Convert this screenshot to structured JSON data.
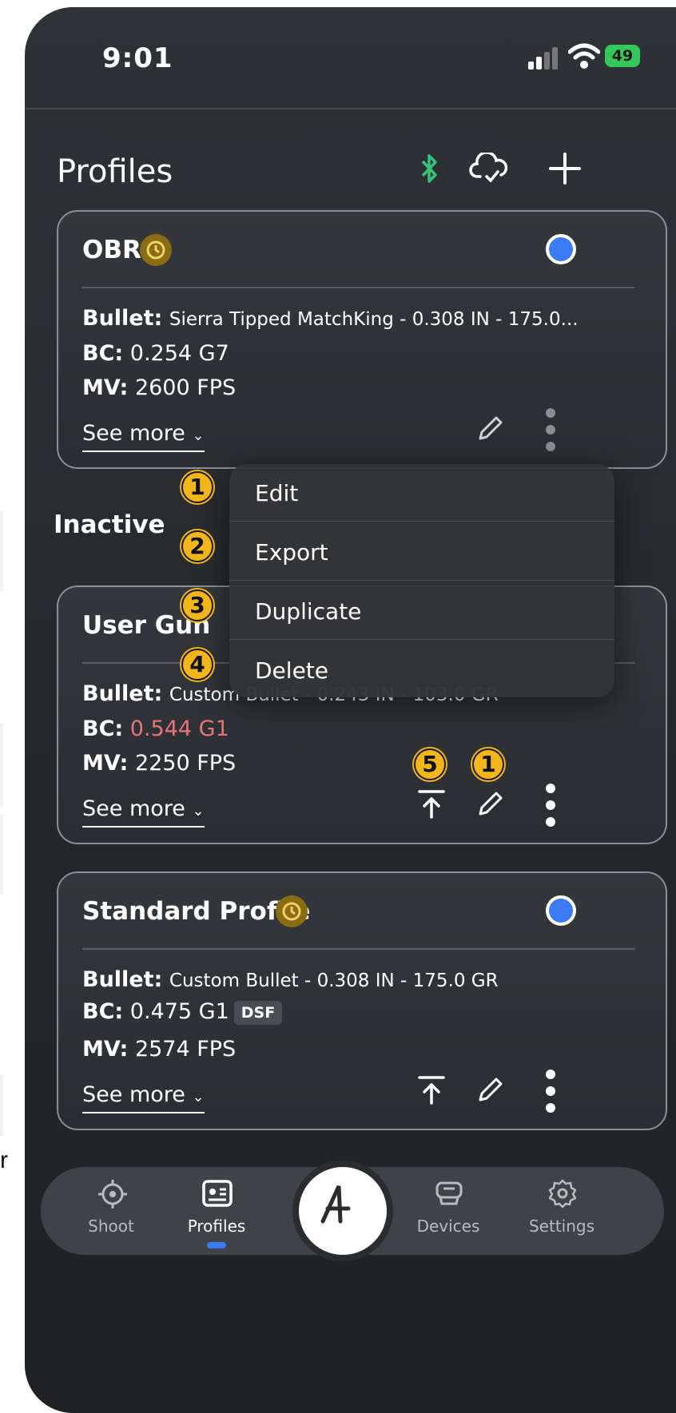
{
  "status": {
    "time": "9:01",
    "battery": "49"
  },
  "header": {
    "title": "Profiles"
  },
  "profiles": [
    {
      "name": "OBR",
      "bullet_label": "Bullet:",
      "bullet": "Sierra Tipped MatchKing - 0.308 IN - 175.0...",
      "bc_label": "BC:",
      "bc": "0.254 G7",
      "mv_label": "MV:",
      "mv": "2600 FPS",
      "see_more": "See more"
    },
    {
      "name": "User Gun",
      "bullet_label": "Bullet:",
      "bullet": "Custom Bullet - 0.243 IN - 103.0 GR",
      "bc_label": "BC:",
      "bc": "0.544 G1",
      "mv_label": "MV:",
      "mv": "2250 FPS",
      "see_more": "See more"
    },
    {
      "name": "Standard Profile",
      "bullet_label": "Bullet:",
      "bullet": "Custom Bullet - 0.308 IN - 175.0 GR",
      "bc_label": "BC:",
      "bc": "0.475 G1",
      "bc_tag": "DSF",
      "mv_label": "MV:",
      "mv": "2574 FPS",
      "see_more": "See more"
    }
  ],
  "section": {
    "inactive": "Inactive"
  },
  "context_menu": {
    "items": [
      {
        "label": "Edit",
        "badge": "1"
      },
      {
        "label": "Export",
        "badge": "2"
      },
      {
        "label": "Duplicate",
        "badge": "3"
      },
      {
        "label": "Delete",
        "badge": "4"
      }
    ]
  },
  "annotations": {
    "export_badge": "5",
    "edit_badge": "1"
  },
  "tabbar": {
    "items": [
      {
        "label": "Shoot",
        "icon": "crosshair-icon"
      },
      {
        "label": "Profiles",
        "icon": "profile-card-icon"
      },
      {
        "label": "Devices",
        "icon": "devices-icon"
      },
      {
        "label": "Settings",
        "icon": "gear-icon"
      }
    ]
  },
  "background": {
    "fragment_letter": "r"
  },
  "colors": {
    "accent": "#3b7cf5",
    "badge": "#f2b51a",
    "bc_warning": "#e8757a",
    "bluetooth": "#35c27a"
  }
}
